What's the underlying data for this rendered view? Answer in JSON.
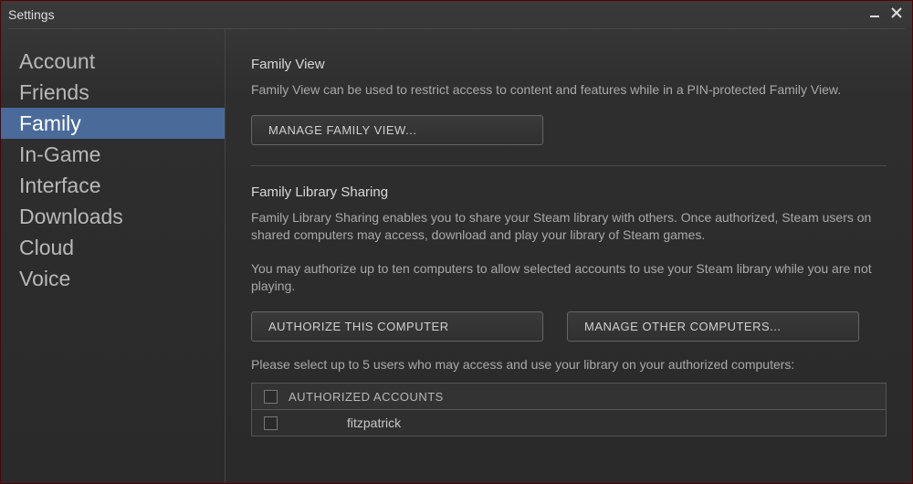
{
  "window": {
    "title": "Settings"
  },
  "sidebar": {
    "items": [
      {
        "label": "Account",
        "selected": false
      },
      {
        "label": "Friends",
        "selected": false
      },
      {
        "label": "Family",
        "selected": true
      },
      {
        "label": "In-Game",
        "selected": false
      },
      {
        "label": "Interface",
        "selected": false
      },
      {
        "label": "Downloads",
        "selected": false
      },
      {
        "label": "Cloud",
        "selected": false
      },
      {
        "label": "Voice",
        "selected": false
      }
    ]
  },
  "familyView": {
    "heading": "Family View",
    "description": "Family View can be used to restrict access to content and features while in a PIN-protected Family View.",
    "manageButton": "MANAGE FAMILY VIEW..."
  },
  "librarySharing": {
    "heading": "Family Library Sharing",
    "description1": "Family Library Sharing enables you to share your Steam library with others. Once authorized, Steam users on shared computers may access, download and play your library of Steam games.",
    "description2": "You may authorize up to ten computers to allow selected accounts to use your Steam library while you are not playing.",
    "authorizeButton": "AUTHORIZE THIS COMPUTER",
    "manageOtherButton": "MANAGE OTHER COMPUTERS...",
    "selectUsersText": "Please select up to 5 users who may access and use your library on your authorized computers:",
    "columnHeader": "AUTHORIZED ACCOUNTS",
    "rows": [
      {
        "name": "fitzpatrick",
        "checked": false
      }
    ]
  }
}
